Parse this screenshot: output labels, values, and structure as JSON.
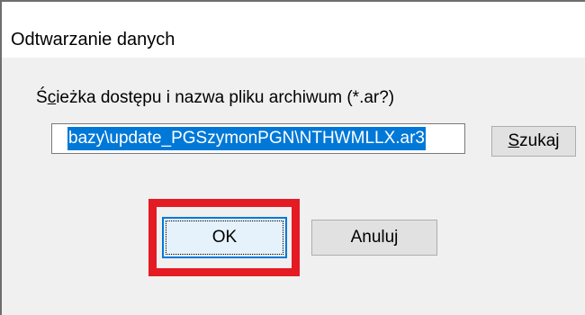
{
  "dialog": {
    "title": "Odtwarzanie danych",
    "path_label": {
      "prefix": "Ś",
      "mnemonic": "c",
      "suffix": "ieżka dostępu i nazwa pliku archiwum (*.ar?)"
    },
    "path_value": "bazy\\update_PGSzymonPGN\\NTHWMLLX.ar3",
    "browse_button": {
      "mnemonic": "S",
      "rest": "zukaj"
    },
    "ok_label": "OK",
    "cancel_label": "Anuluj"
  },
  "colors": {
    "selection": "#0078d7",
    "highlight_frame": "#e41b23",
    "default_button_border": "#0078d7"
  }
}
